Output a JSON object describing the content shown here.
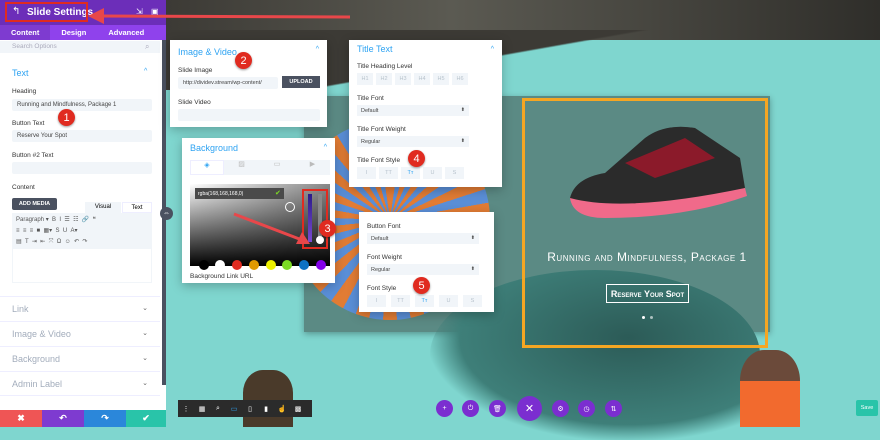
{
  "sidebar": {
    "title": "Slide Settings",
    "tabs": [
      "Content",
      "Design",
      "Advanced"
    ],
    "search_placeholder": "Search Options",
    "text_section": "Text",
    "heading_label": "Heading",
    "heading_value": "Running and Mindfulness, Package 1",
    "button_text_label": "Button Text",
    "button_text_value": "Reserve Your Spot",
    "button2_label": "Button #2 Text",
    "button2_value": "",
    "content_label": "Content",
    "add_media": "ADD MEDIA",
    "editor_tabs": [
      "Visual",
      "Text"
    ],
    "paragraph": "Paragraph",
    "sections": [
      "Link",
      "Image & Video",
      "Background",
      "Admin Label"
    ],
    "footer": {
      "cancel": "✖",
      "undo": "↶",
      "redo": "↷",
      "save": "✔"
    }
  },
  "image_video_panel": {
    "title": "Image & Video",
    "slide_image_label": "Slide Image",
    "slide_image_value": "http://dividev.stream/wp-content/",
    "upload": "UPLOAD",
    "slide_video_label": "Slide Video"
  },
  "background_panel": {
    "title": "Background",
    "color_value": "rgba(168,168,168,0)",
    "link_label": "Background Link URL",
    "swatches": [
      "#000000",
      "#ffffff",
      "#e02b20",
      "#e09900",
      "#edf000",
      "#7cda24",
      "#0c71c3",
      "#8300e9"
    ]
  },
  "title_text_panel": {
    "title": "Title Text",
    "heading_level_label": "Title Heading Level",
    "levels": [
      "H1",
      "H2",
      "H3",
      "H4",
      "H5",
      "H6"
    ],
    "font_label": "Title Font",
    "font_value": "Default",
    "weight_label": "Title Font Weight",
    "weight_value": "Regular",
    "style_label": "Title Font Style",
    "styles": [
      "I",
      "TT",
      "Tт",
      "U",
      "S"
    ]
  },
  "button_panel": {
    "font_label": "Button Font",
    "font_value": "Default",
    "weight_label": "Font Weight",
    "weight_value": "Regular",
    "style_label": "Font Style",
    "styles": [
      "I",
      "TT",
      "Tт",
      "U",
      "S"
    ]
  },
  "slide": {
    "title": "Running and Mindfulness, Package 1",
    "button": "Reserve Your Spot"
  },
  "badges": [
    "1",
    "2",
    "3",
    "4",
    "5"
  ],
  "canvas": {
    "save": "Save"
  },
  "colors": {
    "purple": "#6c2eb9",
    "accent": "#2ea3f2",
    "orange": "#f5a623",
    "annotation": "#e02b20"
  }
}
